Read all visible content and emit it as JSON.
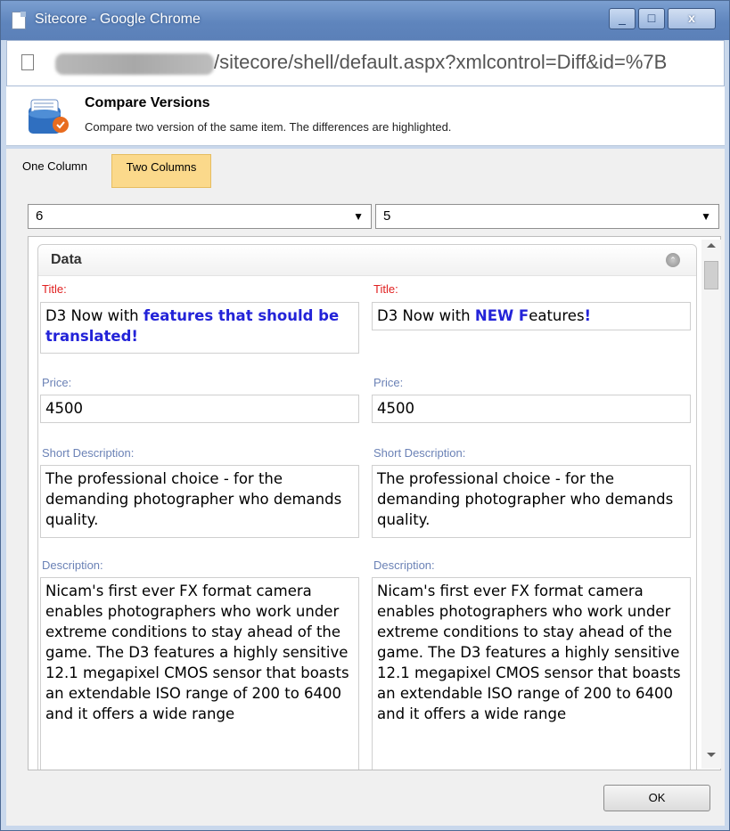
{
  "window": {
    "title": "Sitecore - Google Chrome",
    "minimize_glyph": "_",
    "maximize_glyph": "□",
    "close_glyph": "x"
  },
  "address": {
    "url_visible": "/sitecore/shell/default.aspx?xmlcontrol=Diff&id=%7B"
  },
  "header": {
    "icon": "compare-versions-icon",
    "title": "Compare Versions",
    "subtitle": "Compare two version of the same item. The differences are highlighted."
  },
  "tabs": [
    {
      "label": "One Column",
      "active": false
    },
    {
      "label": "Two Columns",
      "active": true
    }
  ],
  "versions": {
    "left": "6",
    "right": "5",
    "arrow": "▼"
  },
  "section": {
    "title": "Data",
    "collapse_icon": "collapse-up-icon"
  },
  "fields": {
    "title_label": "Title:",
    "title_left": {
      "plain1": "D3 Now with ",
      "diff1": "features that should be translated!"
    },
    "title_right": {
      "plain1": "D3 Now with ",
      "diff1": "NEW F",
      "plain2": "eatures",
      "diff2": "!"
    },
    "price_label": "Price:",
    "price_left": "4500",
    "price_right": "4500",
    "short_label": "Short Description:",
    "short_left": "The professional choice - for the demanding photographer who demands quality.",
    "short_right": "The professional choice - for the demanding photographer who demands quality.",
    "desc_label": "Description:",
    "desc_left": "Nicam's first ever FX format camera enables photographers who work under extreme conditions to stay ahead of the game. The D3 features a highly sensitive 12.1 megapixel CMOS sensor that boasts an extendable ISO range of 200 to 6400 and it offers a wide range",
    "desc_right": "Nicam's first ever FX format camera enables photographers who work under extreme conditions to stay ahead of the game. The D3 features a highly sensitive 12.1 megapixel CMOS sensor that boasts an extendable ISO range of 200 to 6400 and it offers a wide range"
  },
  "footer": {
    "ok_label": "OK"
  },
  "colors": {
    "changed_label": "#e02020",
    "normal_label": "#6b82b6",
    "diff_text": "#2323d8",
    "active_tab": "#fbd98b"
  }
}
